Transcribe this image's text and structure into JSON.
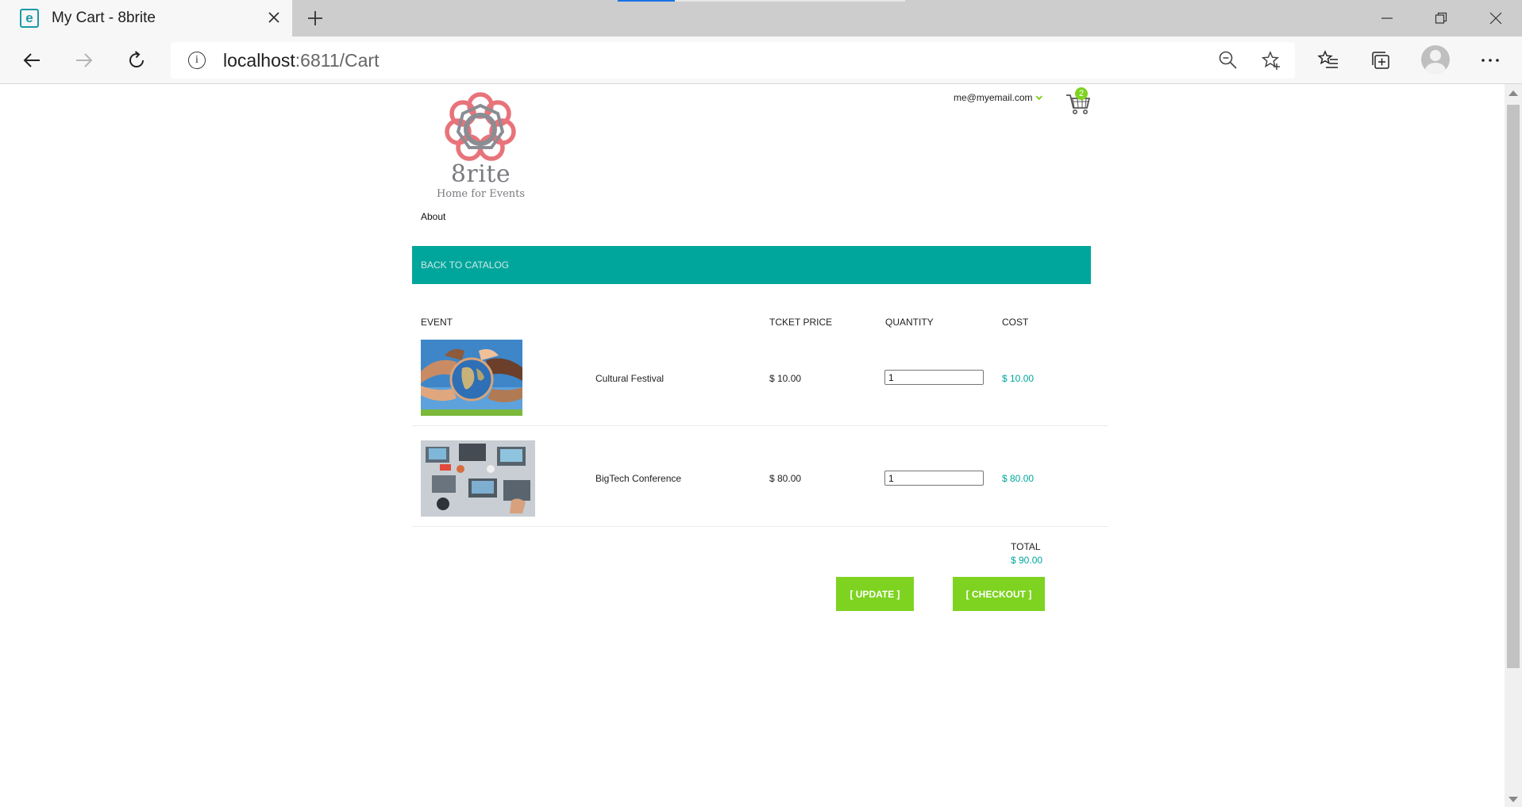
{
  "browser": {
    "tab_title": "My Cart - 8brite",
    "favicon_letter": "e",
    "url_host": "localhost",
    "url_rest": ":6811/Cart"
  },
  "header": {
    "brand_name": "8rite",
    "brand_tagline": "Home for Events",
    "user_email": "me@myemail.com",
    "cart_count": "2"
  },
  "nav": {
    "about": "About",
    "back_to_catalog": "BACK TO CATALOG"
  },
  "cart": {
    "headers": {
      "event": "EVENT",
      "ticket_price": "TCKET PRICE",
      "quantity": "QUANTITY",
      "cost": "COST"
    },
    "items": [
      {
        "name": "Cultural Festival",
        "price": "$ 10.00",
        "quantity": "1",
        "cost": "$ 10.00",
        "image": "globe-in-hands-photo"
      },
      {
        "name": "BigTech Conference",
        "price": "$ 80.00",
        "quantity": "1",
        "cost": "$ 80.00",
        "image": "laptops-on-desk-photo"
      }
    ],
    "total_label": "TOTAL",
    "total_value": "$ 90.00",
    "update_label": "[ UPDATE ]",
    "checkout_label": "[ CHECKOUT ]"
  },
  "colors": {
    "teal": "#00a69c",
    "green": "#7ed321",
    "logo_coral": "#e8737a",
    "logo_grey": "#8a8d93"
  }
}
